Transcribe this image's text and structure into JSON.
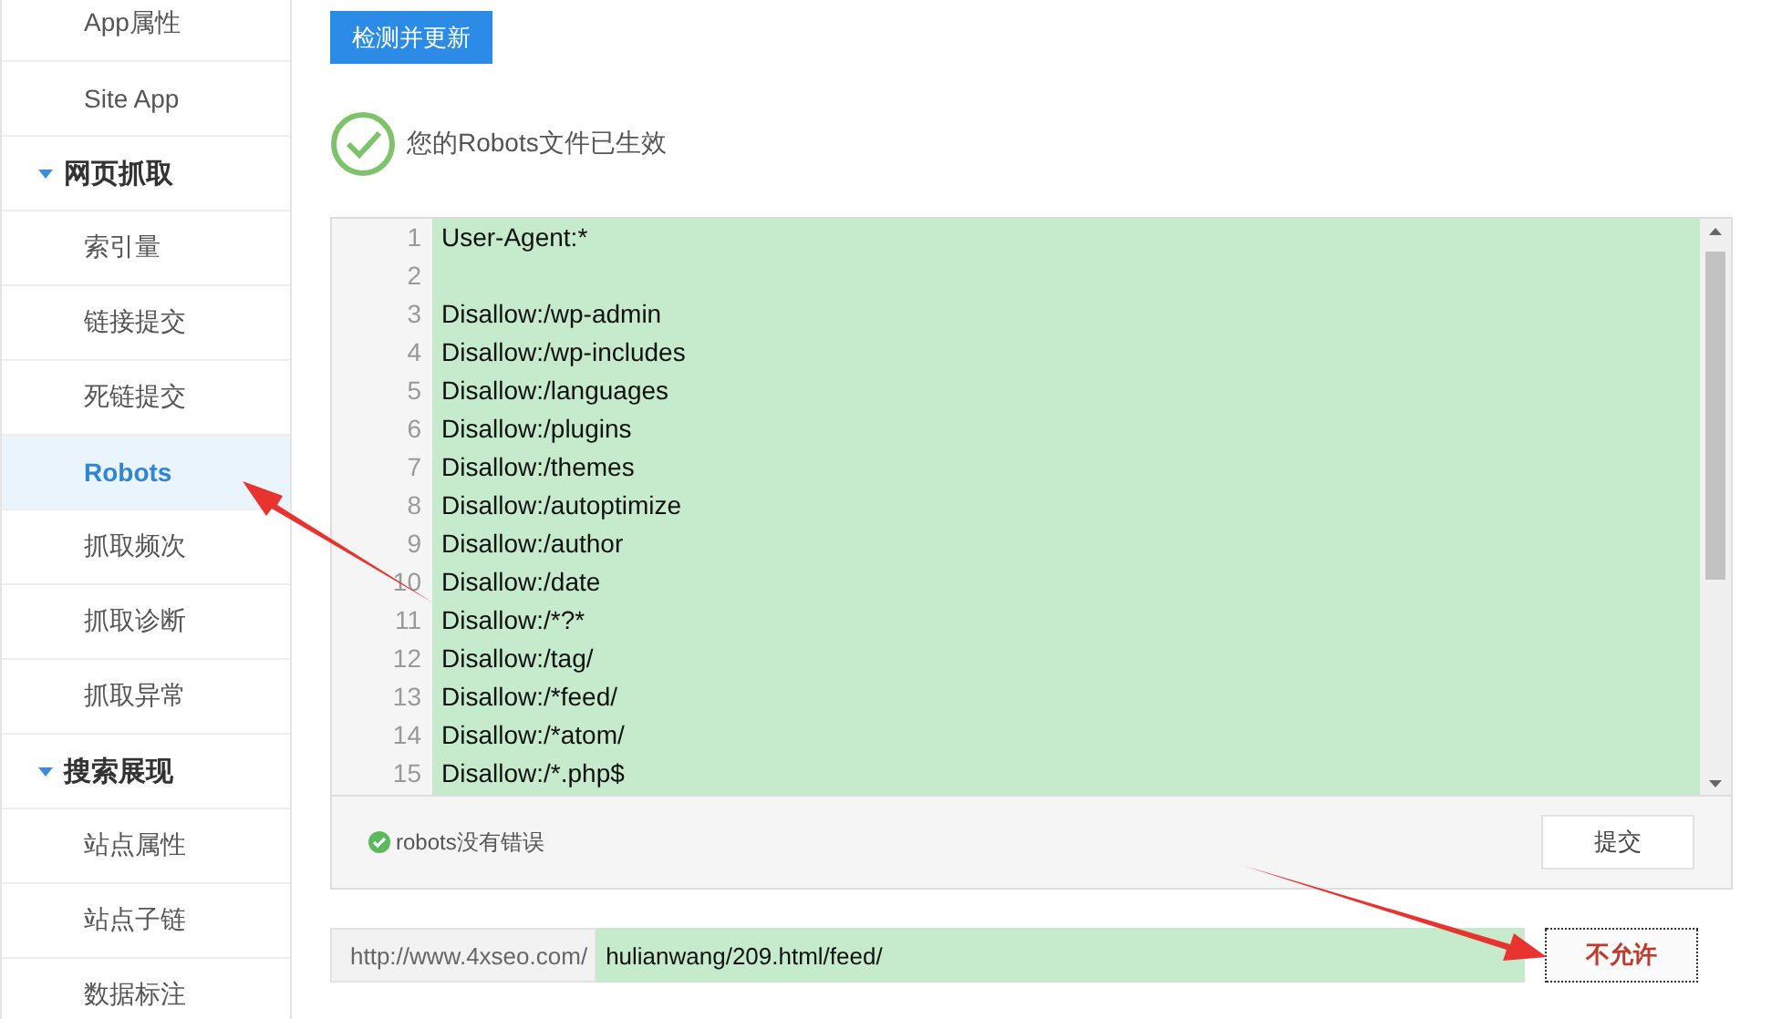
{
  "sidebar": {
    "items": [
      {
        "kind": "item",
        "label": "App属性",
        "selected": false
      },
      {
        "kind": "item",
        "label": "Site App",
        "selected": false
      },
      {
        "kind": "section",
        "label": "网页抓取",
        "expanded": true
      },
      {
        "kind": "item",
        "label": "索引量",
        "selected": false
      },
      {
        "kind": "item",
        "label": "链接提交",
        "selected": false
      },
      {
        "kind": "item",
        "label": "死链提交",
        "selected": false
      },
      {
        "kind": "item",
        "label": "Robots",
        "selected": true
      },
      {
        "kind": "item",
        "label": "抓取频次",
        "selected": false
      },
      {
        "kind": "item",
        "label": "抓取诊断",
        "selected": false
      },
      {
        "kind": "item",
        "label": "抓取异常",
        "selected": false
      },
      {
        "kind": "section",
        "label": "搜索展现",
        "expanded": true
      },
      {
        "kind": "item",
        "label": "站点属性",
        "selected": false
      },
      {
        "kind": "item",
        "label": "站点子链",
        "selected": false
      },
      {
        "kind": "item",
        "label": "数据标注",
        "selected": false
      }
    ]
  },
  "update_button": "检测并更新",
  "status": {
    "text": "您的Robots文件已生效"
  },
  "editor": {
    "lines": [
      {
        "number": "1",
        "text": "User-Agent:*"
      },
      {
        "number": "2"
      },
      {
        "number": "3",
        "text": "Disallow:/wp-admin"
      },
      {
        "number": "4",
        "text": "Disallow:/wp-includes"
      },
      {
        "number": "5",
        "text": "Disallow:/languages"
      },
      {
        "number": "6",
        "text": "Disallow:/plugins"
      },
      {
        "number": "7",
        "text": "Disallow:/themes"
      },
      {
        "number": "8",
        "text": "Disallow:/autoptimize"
      },
      {
        "number": "9",
        "text": "Disallow:/author"
      },
      {
        "number": "10",
        "text": "Disallow:/date"
      },
      {
        "number": "11",
        "text": "Disallow:/*?*"
      },
      {
        "number": "12",
        "text": "Disallow:/tag/"
      },
      {
        "number": "13",
        "text": "Disallow:/*feed/"
      },
      {
        "number": "14",
        "text": "Disallow:/*atom/"
      },
      {
        "number": "15",
        "text": "Disallow:/*.php$"
      }
    ],
    "check_message": "robots没有错误",
    "submit_button": "提交"
  },
  "url_test": {
    "prefix": "http://www.4xseo.com/",
    "value": "hulianwang/209.html/feed/",
    "result_button": "不允许"
  }
}
